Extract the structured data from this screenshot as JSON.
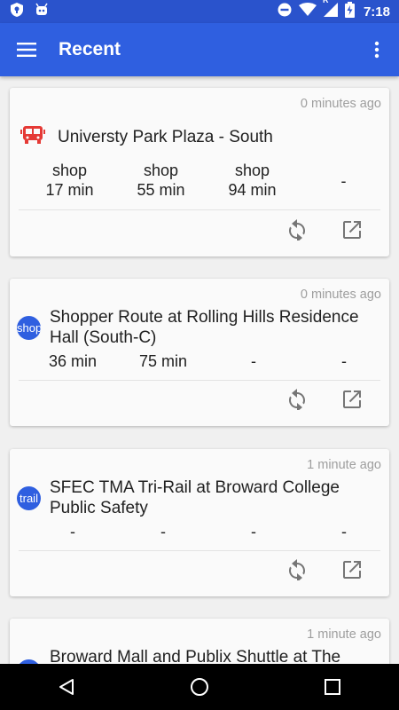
{
  "status_bar": {
    "time": "7:18",
    "icons": [
      "shield-icon",
      "android-icon",
      "do-not-disturb-icon",
      "wifi-icon",
      "roaming-r-icon",
      "signal-icon",
      "battery-charging-icon"
    ],
    "roaming_label": "R"
  },
  "app_bar": {
    "title": "Recent",
    "menu_icon": "hamburger-menu-icon",
    "overflow_icon": "more-vert-icon"
  },
  "colors": {
    "status_bar": "#2a53cc",
    "app_bar": "#2f5fe0",
    "route_badge": "#2f5fe0",
    "bus_icon": "#e53935",
    "background": "#f0f0f0",
    "card": "#fafafa"
  },
  "cards": [
    {
      "timestamp": "0 minutes ago",
      "icon": "bus-icon",
      "stop_name": "Universty Park Plaza - South",
      "times": [
        {
          "route": "shop",
          "time": "17 min"
        },
        {
          "route": "shop",
          "time": "55 min"
        },
        {
          "route": "shop",
          "time": "94 min"
        },
        {
          "route": "",
          "time": "-"
        }
      ]
    },
    {
      "timestamp": "0 minutes ago",
      "badge": "shop",
      "stop_name_line1": "Shopper Route at Rolling Hills Residence",
      "stop_name_line2": "Hall (South-C)",
      "times": [
        "36 min",
        "75 min",
        "-",
        "-"
      ]
    },
    {
      "timestamp": "1 minute ago",
      "badge": "trail",
      "stop_name_line1": "SFEC TMA Tri-Rail at Broward College",
      "stop_name_line2": "Public Safety",
      "times": [
        "-",
        "-",
        "-",
        "-"
      ]
    },
    {
      "timestamp": "1 minute ago",
      "badge": "",
      "stop_name_line1": "Broward Mall and Publix Shuttle at The"
    }
  ],
  "actions": {
    "refresh_icon": "refresh-icon",
    "open_icon": "open-in-new-icon"
  },
  "nav_bar": [
    "back-icon",
    "home-icon",
    "recents-icon"
  ]
}
